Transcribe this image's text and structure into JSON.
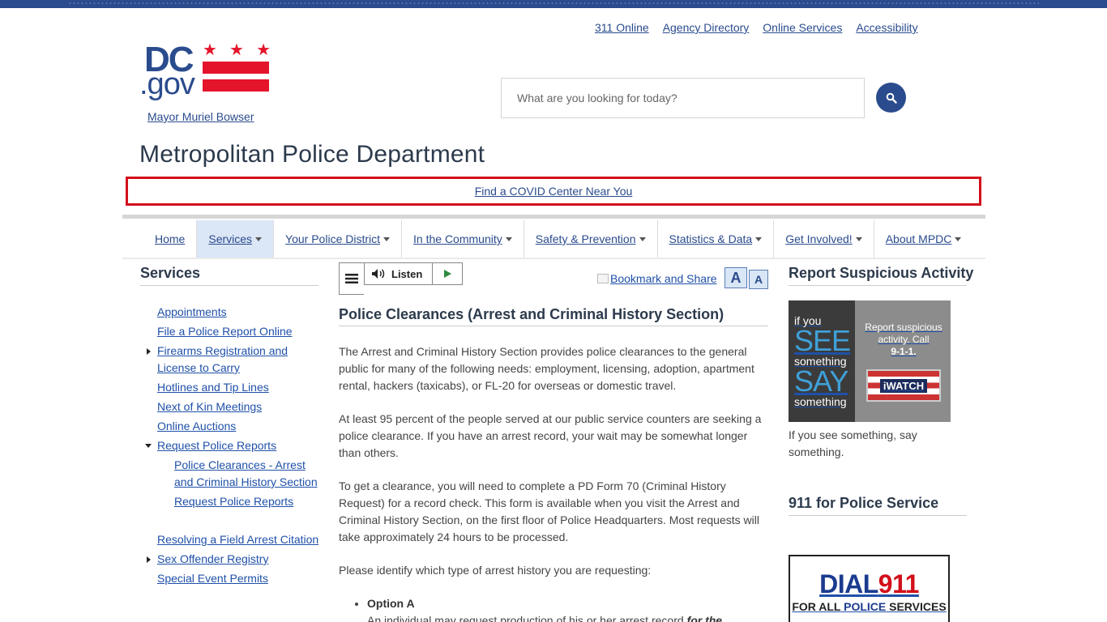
{
  "utility_links": [
    "311 Online",
    "Agency Directory",
    "Online Services",
    "Accessibility"
  ],
  "logo": {
    "dc": "DC",
    "gov": ".gov"
  },
  "mayor_link": "Mayor Muriel Bowser",
  "search": {
    "placeholder": "What are you looking for today?"
  },
  "agency_title": "Metropolitan Police Department",
  "covid_banner": "Find a COVID Center Near You",
  "main_nav": [
    {
      "label": "Home"
    },
    {
      "label": "Services"
    },
    {
      "label": "Your Police District"
    },
    {
      "label": "In the Community"
    },
    {
      "label": "Safety & Prevention"
    },
    {
      "label": "Statistics & Data"
    },
    {
      "label": "Get Involved!"
    },
    {
      "label": "About MPDC"
    }
  ],
  "sidebar": {
    "title": "Services",
    "items": [
      "Appointments",
      "File a Police Report Online",
      "Firearms Registration and License to Carry",
      "Hotlines and Tip Lines",
      "Next of Kin Meetings",
      "Online Auctions",
      "Request Police Reports",
      "Police Clearances - Arrest and Criminal History Section",
      "Request Police Reports",
      "Resolving a Field Arrest Citation",
      "Sex Offender Registry",
      "Special Event Permits"
    ]
  },
  "listen": {
    "label": "Listen"
  },
  "bookmark_label": "Bookmark and Share",
  "font_buttons": {
    "increase": "A",
    "decrease": "A"
  },
  "article": {
    "title": "Police Clearances (Arrest and Criminal History Section)",
    "paragraphs": [
      "The Arrest and Criminal History Section provides police clearances to the general public for many of the following needs: employment, licensing, adoption, apartment rental, hackers (taxicabs), or FL-20 for overseas or domestic travel.",
      "At least 95 percent of the people served at our public service counters are seeking a police clearance. If you have an arrest record, your wait may be somewhat longer than others.",
      "To get a clearance, you will need to complete a PD Form 70 (Criminal History Request) for a record check. This form is available when you visit the Arrest and Criminal History Section, on the first floor of Police Headquarters. Most requests will take approximately 24 hours to be processed.",
      "Please identify which type of arrest history you are requesting:"
    ],
    "option_a_label": "Option A",
    "option_a_text": "An individual may request production of his or her arrest record",
    "option_a_emph": "for the"
  },
  "right": {
    "suspicious_title": "Report Suspicious Activity",
    "iwatch": {
      "if_you": "if you",
      "see": "SEE",
      "something1": "something",
      "say": "SAY",
      "something2": "something",
      "report_text": "Report suspicious activity. Call",
      "number": "9-1-1.",
      "brand": "iWATCH"
    },
    "caption": "If you see something, say something.",
    "police_title": "911 for Police Service",
    "dial": {
      "dial": "DIAL",
      "num": "911",
      "line2_a": "FOR ALL",
      "line2_b": "POLICE",
      "line2_c": "SERVICES"
    }
  },
  "colors": {
    "brand_blue": "#2a4b8d",
    "dc_red": "#e4142b",
    "banner_red": "#d20f1b"
  }
}
